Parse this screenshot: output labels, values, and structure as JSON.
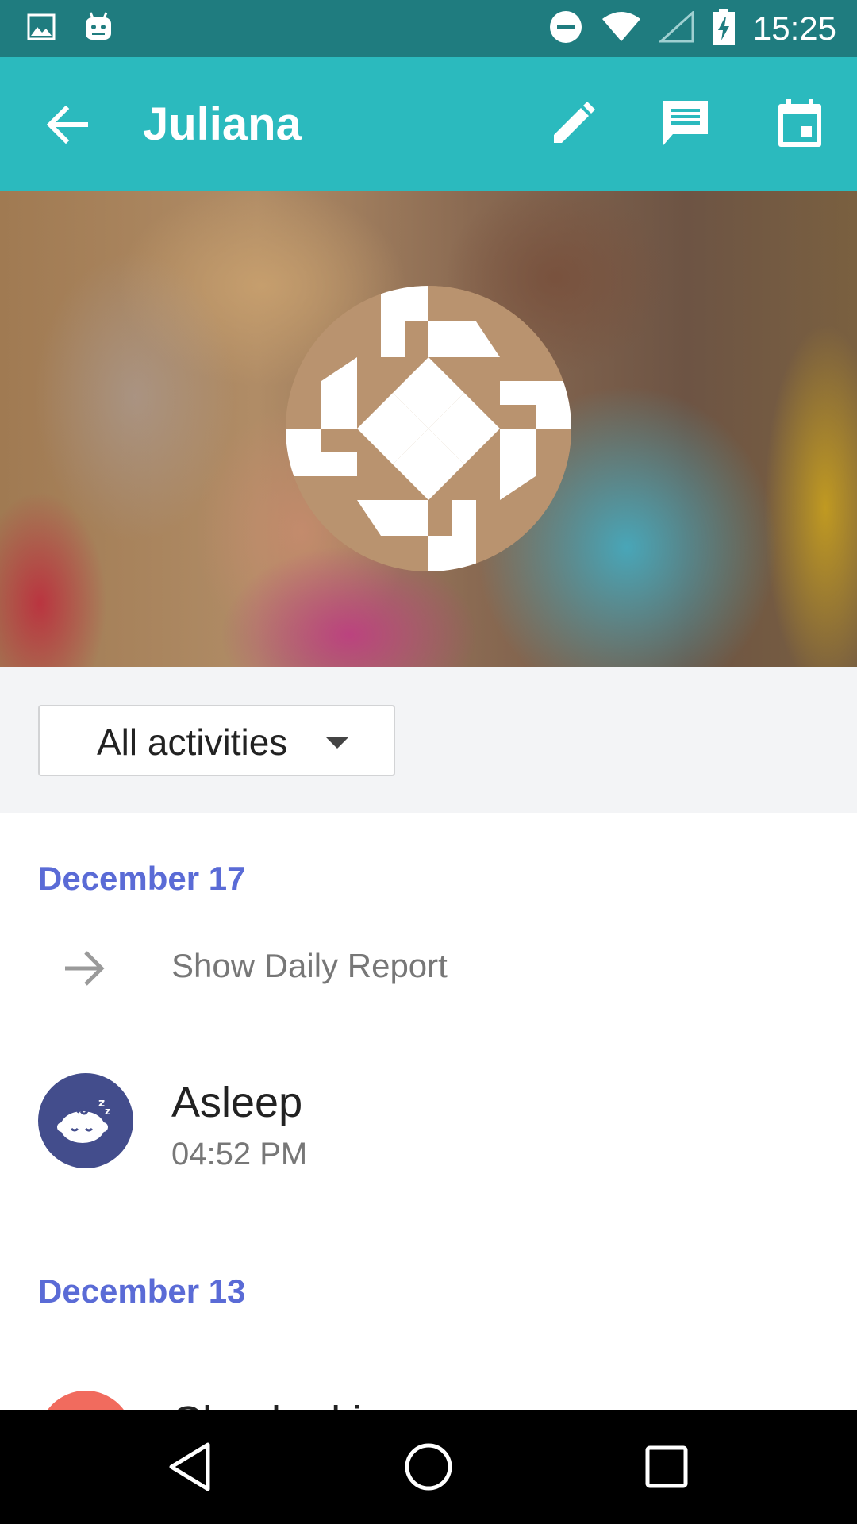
{
  "status_bar": {
    "time": "15:25",
    "icons": [
      "image-icon",
      "android-icon",
      "do-not-disturb-icon",
      "wifi-icon",
      "signal-icon",
      "battery-charging-icon"
    ]
  },
  "app_bar": {
    "title": "Juliana",
    "back_icon": "arrow-back-icon",
    "actions": [
      "edit-icon",
      "message-icon",
      "calendar-icon"
    ],
    "background": "#2bbabe"
  },
  "filter": {
    "selected": "All activities"
  },
  "feed": {
    "groups": [
      {
        "date": "December 17",
        "report_link": "Show Daily Report",
        "activities": [
          {
            "name": "Asleep",
            "time": "04:52 PM",
            "icon": "sleeping-baby-icon",
            "color": "#434d8c"
          }
        ]
      },
      {
        "date": "December 13",
        "activities": [
          {
            "name": "Checked in",
            "color": "#f16b5e"
          }
        ]
      }
    ]
  },
  "colors": {
    "accent": "#5a6bd6",
    "status_bar": "#1f7c7f"
  }
}
